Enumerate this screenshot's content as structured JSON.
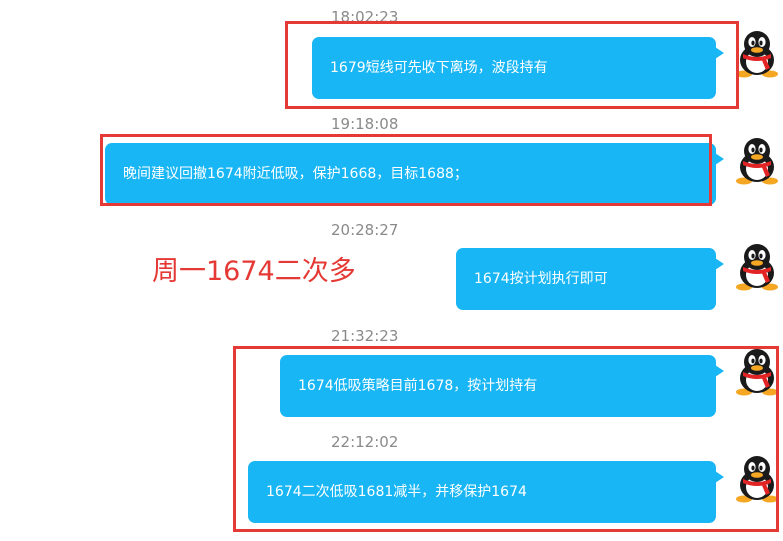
{
  "chat": {
    "messages": [
      {
        "time": "18:02:23",
        "text": "1679短线可先收下离场，波段持有"
      },
      {
        "time": "19:18:08",
        "text": "晚间建议回撤1674附近低吸，保护1668，目标1688；"
      },
      {
        "time": "20:28:27",
        "text": "1674按计划执行即可"
      },
      {
        "time": "21:32:23",
        "text": "1674低吸策略目前1678，按计划持有"
      },
      {
        "time": "22:12:02",
        "text": "1674二次低吸1681减半，并移保护1674"
      }
    ]
  },
  "annotation": {
    "text": "周一1674二次多",
    "color": "#e53935"
  },
  "colors": {
    "bubble": "#19b6f5",
    "highlight": "#e53935",
    "timestamp": "#8a8a8a"
  },
  "icons": {
    "avatar": "qq-penguin-icon"
  }
}
